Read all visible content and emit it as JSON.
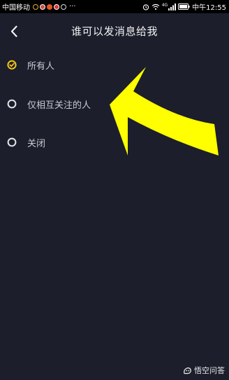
{
  "status_bar": {
    "carrier": "中国移动",
    "more": "···",
    "network_type": "4G",
    "time": "中午12:55"
  },
  "header": {
    "title": "谁可以发消息给我"
  },
  "options": [
    {
      "label": "所有人",
      "selected": true
    },
    {
      "label": "仅相互关注的人",
      "selected": false
    },
    {
      "label": "关闭",
      "selected": false
    }
  ],
  "watermark": {
    "text": "悟空问答"
  },
  "colors": {
    "background": "#1c1e2b",
    "accent": "#f5c518",
    "arrow": "#ffff00",
    "text": "#f2f2f4"
  }
}
